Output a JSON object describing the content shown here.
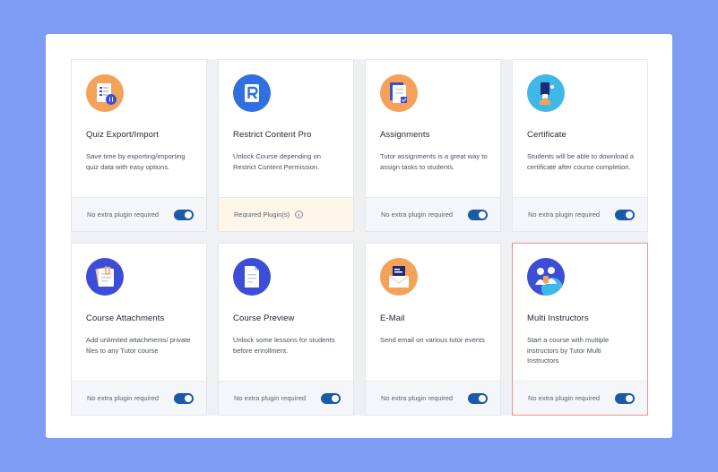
{
  "cards": [
    {
      "title": "Quiz Export/Import",
      "desc": "Save time by exporting/importing quiz data with easy options.",
      "footer": "No extra plugin required",
      "icon": "quiz-export-icon",
      "icon_color": "#f4a259",
      "enabled": true
    },
    {
      "title": "Restrict Content Pro",
      "desc": "Unlock Course depending on Restrict Content Permission.",
      "footer": "Required Plugin(s)",
      "icon": "restrict-content-icon",
      "icon_color": "#2f6fe0",
      "enabled": false
    },
    {
      "title": "Assignments",
      "desc": "Tutor assignments is a great way to assign tasks to students.",
      "footer": "No extra plugin required",
      "icon": "assignments-icon",
      "icon_color": "#f4a259",
      "enabled": true
    },
    {
      "title": "Certificate",
      "desc": "Students will be able to download a certificate after course completion.",
      "footer": "No extra plugin required",
      "icon": "certificate-icon",
      "icon_color": "#3fb8e8",
      "enabled": true
    },
    {
      "title": "Course Attachments",
      "desc": "Add unlimited attachments/ private files to any Tutor course",
      "footer": "No extra plugin required",
      "icon": "attachments-icon",
      "icon_color": "#3c4ed8",
      "enabled": true
    },
    {
      "title": "Course Preview",
      "desc": "Unlock some lessons for students before enrollment.",
      "footer": "No extra plugin required",
      "icon": "course-preview-icon",
      "icon_color": "#3c4ed8",
      "enabled": true
    },
    {
      "title": "E-Mail",
      "desc": "Send email on various tutor events",
      "footer": "No extra plugin required",
      "icon": "email-icon",
      "icon_color": "#f4a259",
      "enabled": true
    },
    {
      "title": "Multi Instructors",
      "desc": "Start a course with multiple instructors by Tutor Multi Instructors",
      "footer": "No extra plugin required",
      "icon": "multi-instructors-icon",
      "icon_color": "#3c4ed8",
      "enabled": true
    }
  ]
}
